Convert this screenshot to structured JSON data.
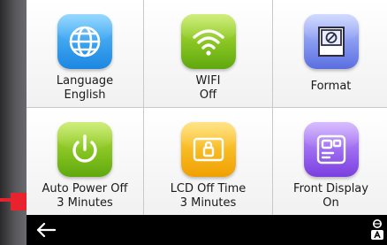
{
  "tiles": [
    {
      "title": "Language",
      "value": "English",
      "icon": "globe-icon",
      "color": "#1d86e0"
    },
    {
      "title": "WIFI",
      "value": "Off",
      "icon": "wifi-icon",
      "color": "#5fa80e"
    },
    {
      "title": "Format",
      "value": "",
      "icon": "sd-card-icon",
      "color": "#5a6fe0"
    },
    {
      "title": "Auto Power Off",
      "value": "3 Minutes",
      "icon": "power-icon",
      "color": "#5fa80e"
    },
    {
      "title": "LCD Off Time",
      "value": "3 Minutes",
      "icon": "screen-lock-icon",
      "color": "#f0a000"
    },
    {
      "title": "Front Display",
      "value": "On",
      "icon": "front-display-icon",
      "color": "#7a3fe0"
    }
  ],
  "bottom_bar": {
    "back_icon": "back-arrow-icon",
    "language_icon": "language-toggle-icon"
  }
}
